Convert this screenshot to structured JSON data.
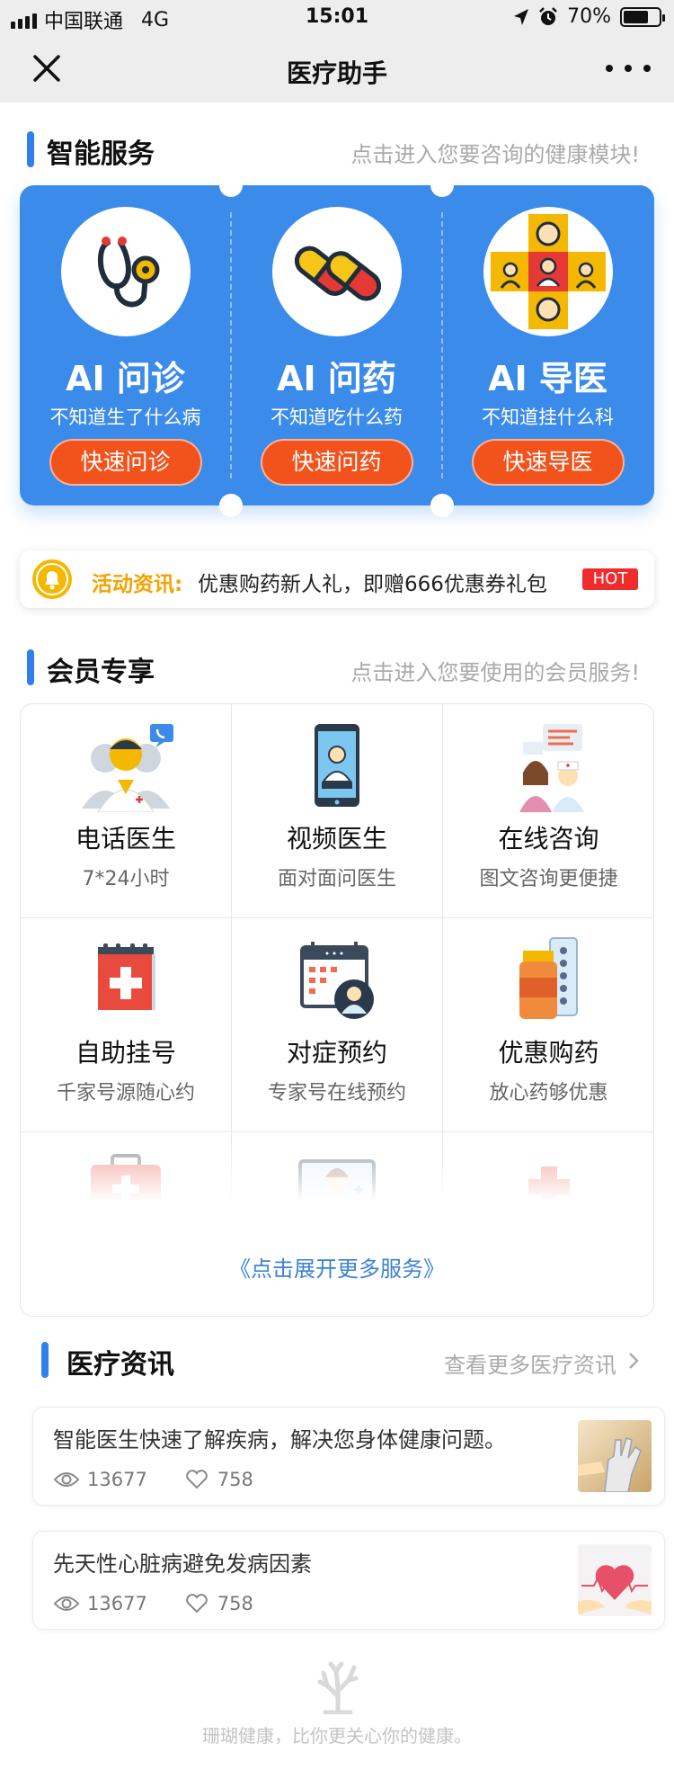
{
  "status_bar": {
    "carrier": "中国联通",
    "network": "4G",
    "time": "15:01",
    "battery": "70%",
    "battery_level": 0.7
  },
  "nav": {
    "title": "医疗助手",
    "close_icon": "close-icon",
    "more_icon": "more-icon"
  },
  "smart_services": {
    "title": "智能服务",
    "hint": "点击进入您要咨询的健康模块!",
    "accent": "#3b8bea",
    "items": [
      {
        "title": "AI 问诊",
        "subtitle": "不知道生了什么病",
        "button": "快速问诊",
        "icon": "stethoscope-icon"
      },
      {
        "title": "AI 问药",
        "subtitle": "不知道吃什么药",
        "button": "快速问药",
        "icon": "pill-capsules-icon"
      },
      {
        "title": "AI 导医",
        "subtitle": "不知道挂什么科",
        "button": "快速导医",
        "icon": "department-guide-icon"
      }
    ]
  },
  "news_ticker": {
    "label": "活动资讯:",
    "text": "优惠购药新人礼，即赠666优惠券礼包",
    "badge": "HOT",
    "icon": "bell-icon"
  },
  "member": {
    "title": "会员专享",
    "hint": "点击进入您要使用的会员服务!",
    "items": [
      {
        "title": "电话医生",
        "subtitle": "7*24小时",
        "icon": "phone-doctor-icon"
      },
      {
        "title": "视频医生",
        "subtitle": "面对面问医生",
        "icon": "video-doctor-icon"
      },
      {
        "title": "在线咨询",
        "subtitle": "图文咨询更便捷",
        "icon": "online-consult-icon"
      },
      {
        "title": "自助挂号",
        "subtitle": "千家号源随心约",
        "icon": "calendar-register-icon"
      },
      {
        "title": "对症预约",
        "subtitle": "专家号在线预约",
        "icon": "appointment-icon"
      },
      {
        "title": "优惠购药",
        "subtitle": "放心药够优惠",
        "icon": "medicine-bottle-icon"
      }
    ],
    "more_icons": [
      "first-aid-kit-icon",
      "doctor-screen-icon",
      "red-cross-icon"
    ],
    "expand": "《点击展开更多服务》"
  },
  "medical_news": {
    "title": "医疗资讯",
    "more": "查看更多医疗资讯",
    "items": [
      {
        "title": "智能医生快速了解疾病，解决您身体健康问题。",
        "views": "13677",
        "likes": "758",
        "thumb": "robot-hand-thumbnail"
      },
      {
        "title": "先天性心脏病避免发病因素",
        "views": "13677",
        "likes": "758",
        "thumb": "heart-hands-thumbnail"
      }
    ]
  },
  "footer": {
    "text": "珊瑚健康，比你更关心你的健康。",
    "logo": "coral-logo-icon"
  }
}
